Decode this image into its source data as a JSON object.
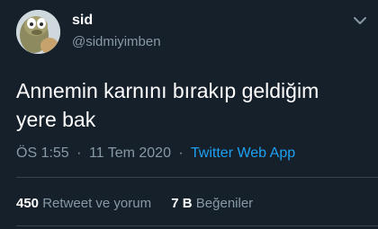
{
  "author": {
    "name": "sid",
    "handle": "@sidmiyimben"
  },
  "tweet": {
    "text_line1": "Annemin karnını bırakıp geldiğim",
    "text_line2": "yere bak"
  },
  "meta": {
    "time": "ÖS 1:55",
    "separator": "·",
    "date": "11 Tem 2020",
    "source": "Twitter Web App"
  },
  "stats": {
    "retweets_count": "450",
    "retweets_label": "Retweet ve yorum",
    "likes_count": "7 B",
    "likes_label": "Beğeniler"
  },
  "colors": {
    "background": "#15202b",
    "text": "#ffffff",
    "secondary": "#8899a6",
    "accent": "#1da1f2",
    "divider": "#38444d"
  },
  "icons": {
    "avatar": "sloth-avatar",
    "menu": "chevron-down-icon"
  }
}
